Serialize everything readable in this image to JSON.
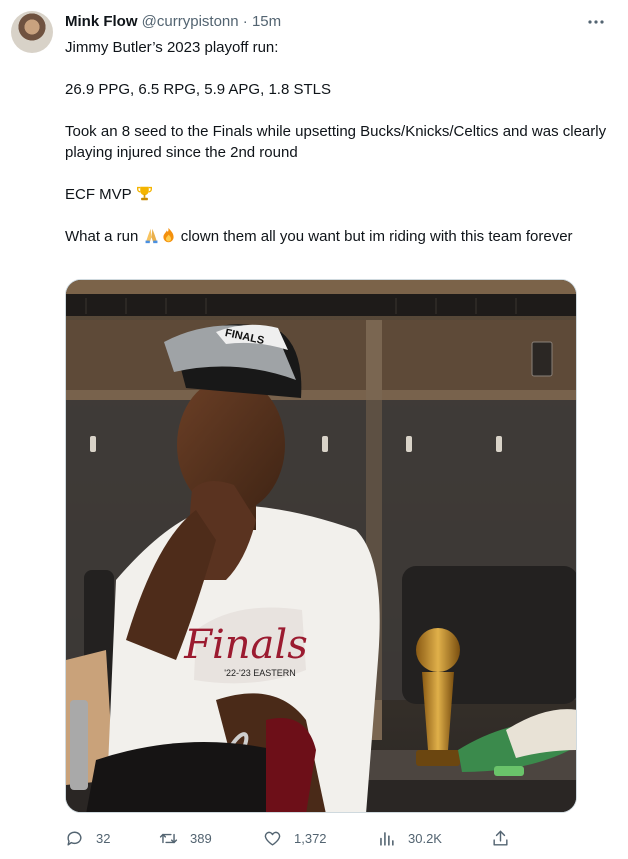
{
  "author": {
    "name": "Mink Flow",
    "handle": "@currypistonn",
    "separator": "·",
    "time": "15m"
  },
  "tweet": {
    "line1": "Jimmy Butler’s 2023 playoff run:",
    "line2": "26.9 PPG, 6.5 RPG, 5.9 APG, 1.8 STLS",
    "line3": "Took an 8 seed to the Finals while upsetting Bucks/Knicks/Celtics and was clearly playing injured since the 2nd round",
    "line4_text": "ECF MVP ",
    "line5_start": "What a run ",
    "line5_end": " clown them all you want but im riding with this team forever",
    "emojis": [
      "trophy-emoji",
      "folded-hands-emoji",
      "fire-emoji"
    ]
  },
  "media": {
    "hat_text": "FINALS",
    "shirt_text": "Finals",
    "shirt_subtext": "'22-'23 EASTERN"
  },
  "actions": {
    "reply_count": "32",
    "retweet_count": "389",
    "like_count": "1,372",
    "views_count": "30.2K"
  },
  "icons": {
    "more": "more-horizontal-icon",
    "reply": "reply-icon",
    "retweet": "retweet-icon",
    "like": "like-icon",
    "views": "views-icon",
    "share": "share-icon"
  },
  "colors": {
    "text": "#0f1419",
    "secondary": "#536471",
    "border": "#cfd9de"
  }
}
